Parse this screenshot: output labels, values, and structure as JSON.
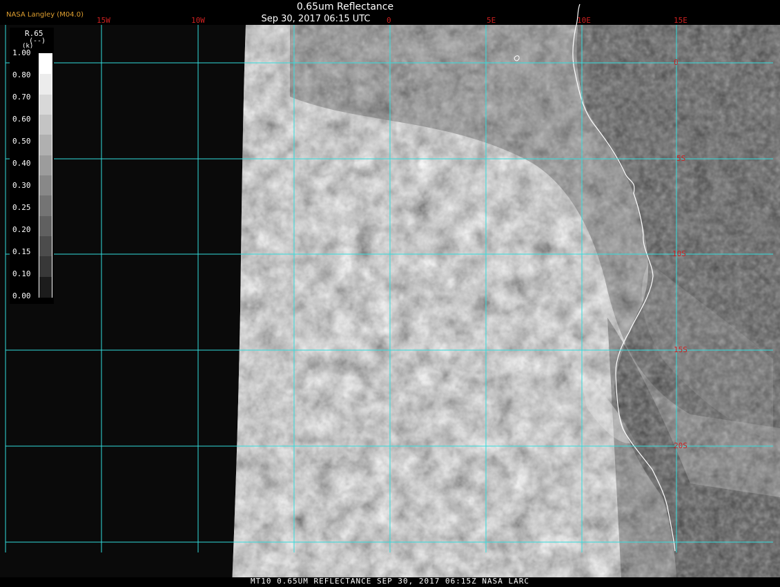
{
  "title": "0.65um Reflectance",
  "datetime": "Sep 30, 2017 06:15 UTC",
  "source_label": "NASA Langley (M04.0)",
  "footer": "MT10  0.65UM REFLECTANCE   SEP 30, 2017 06:15Z   NASA LARC",
  "longitude_labels": [
    "15W",
    "10W",
    "0",
    "5E",
    "10E",
    "15E"
  ],
  "latitude_labels": [
    "0",
    "5S",
    "10S",
    "15S",
    "20S"
  ],
  "legend": {
    "variable": "R.65",
    "units": "(--)",
    "k": "(k)",
    "ticks": [
      "1.00",
      "0.80",
      "0.70",
      "0.60",
      "0.50",
      "0.40",
      "0.30",
      "0.25",
      "0.20",
      "0.15",
      "0.10",
      "0.00"
    ],
    "colors": [
      "#ffffff",
      "#ececec",
      "#d8d8d8",
      "#c4c4c4",
      "#b0b0b0",
      "#9c9c9c",
      "#888888",
      "#747474",
      "#606060",
      "#4c4c4c",
      "#383838",
      "#1c1c1c"
    ]
  },
  "colors": {
    "grid": "#33dddd",
    "coastline": "#ffffff",
    "label_red": "#cc2020",
    "source_orange": "#e0a030"
  }
}
